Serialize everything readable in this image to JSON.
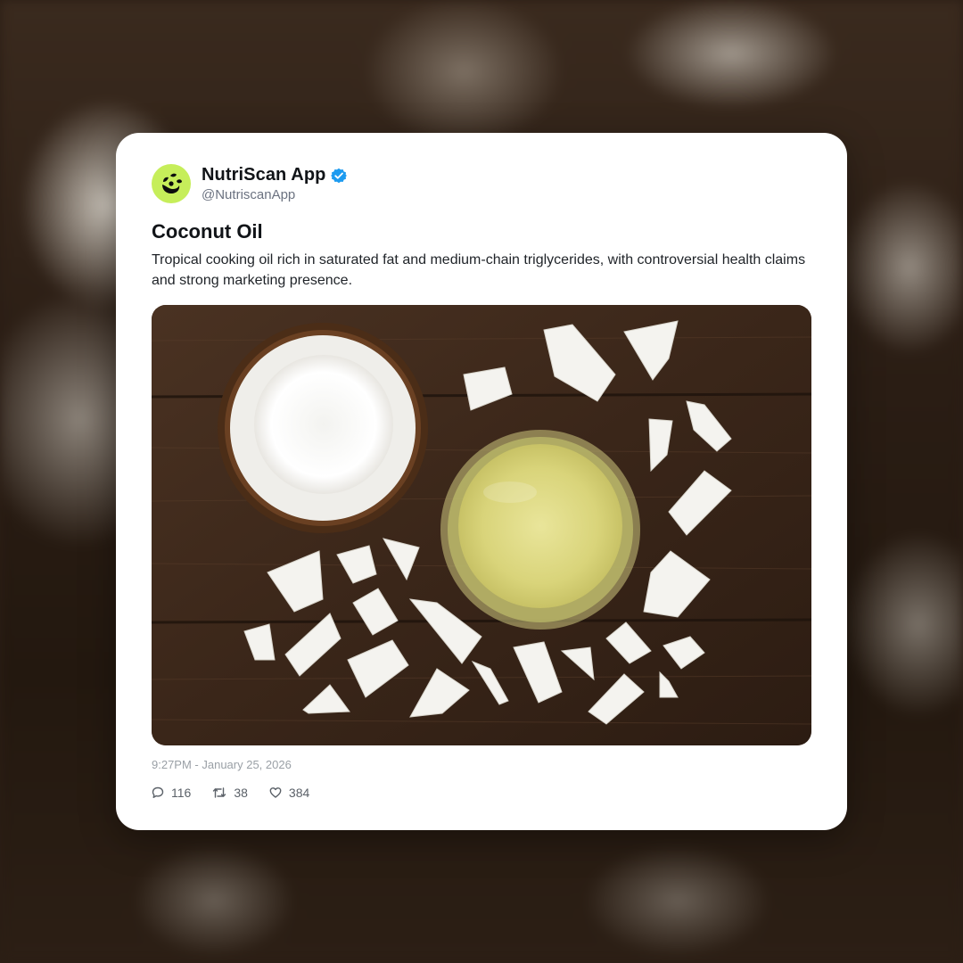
{
  "post": {
    "author": {
      "display_name": "NutriScan App",
      "handle": "@NutriscanApp",
      "verified": true,
      "avatar_icon": "nutriscan-logo-icon",
      "avatar_color": "#c6ee5a"
    },
    "title": "Coconut Oil",
    "body": "Tropical cooking oil rich in saturated fat and medium-chain triglycerides, with controversial health claims and strong marketing presence.",
    "image": {
      "subject": "coconut-oil-photo"
    },
    "timestamp": "9:27PM - January 25, 2026",
    "stats": {
      "replies": "116",
      "reposts": "38",
      "likes": "384"
    }
  },
  "colors": {
    "verified_badge": "#1d9bf0",
    "text_primary": "#111418",
    "text_secondary": "#6b7280"
  }
}
